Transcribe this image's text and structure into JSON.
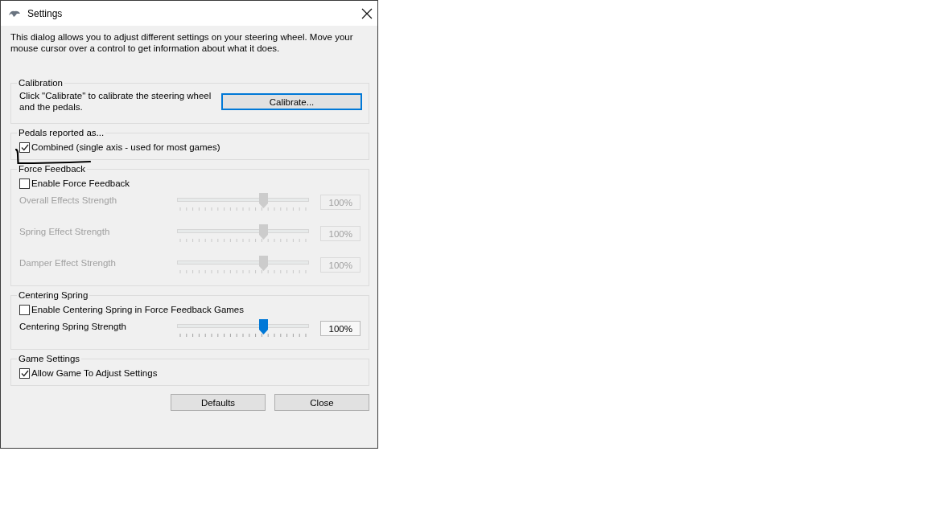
{
  "window": {
    "title": "Settings"
  },
  "description": "This dialog allows you to adjust different settings on your steering wheel.  Move your mouse cursor over a control to get information about what it does.",
  "groups": [
    {
      "title": "Calibration",
      "items": [
        {
          "kind": "action",
          "text": "Click \"Calibrate\" to calibrate the steering wheel and the pedals.",
          "button": {
            "label": "Calibrate...",
            "focused": true
          }
        }
      ]
    },
    {
      "title": "Pedals reported as...",
      "annotated": true,
      "items": [
        {
          "kind": "checkbox",
          "label": "Combined (single axis - used for most games)",
          "checked": true
        }
      ]
    },
    {
      "title": "Force Feedback",
      "items": [
        {
          "kind": "checkbox",
          "label": "Enable Force Feedback",
          "checked": false
        },
        {
          "kind": "slider",
          "label": "Overall Effects Strength",
          "level": 0.65,
          "value": "100%",
          "disabled": true
        },
        {
          "kind": "slider",
          "label": "Spring Effect Strength",
          "level": 0.65,
          "value": "100%",
          "disabled": true
        },
        {
          "kind": "slider",
          "label": "Damper Effect Strength",
          "level": 0.65,
          "value": "100%",
          "disabled": true
        }
      ]
    },
    {
      "title": "Centering Spring",
      "items": [
        {
          "kind": "checkbox",
          "label": "Enable Centering Spring in Force Feedback Games",
          "checked": false
        },
        {
          "kind": "slider",
          "label": "Centering Spring Strength",
          "level": 0.65,
          "value": "100%",
          "disabled": false
        }
      ]
    },
    {
      "title": "Game Settings",
      "items": [
        {
          "kind": "checkbox",
          "label": "Allow Game To Adjust Settings",
          "checked": true
        }
      ]
    }
  ],
  "buttons": [
    {
      "label": "Defaults",
      "focused": false
    },
    {
      "label": "Close",
      "focused": false
    }
  ]
}
